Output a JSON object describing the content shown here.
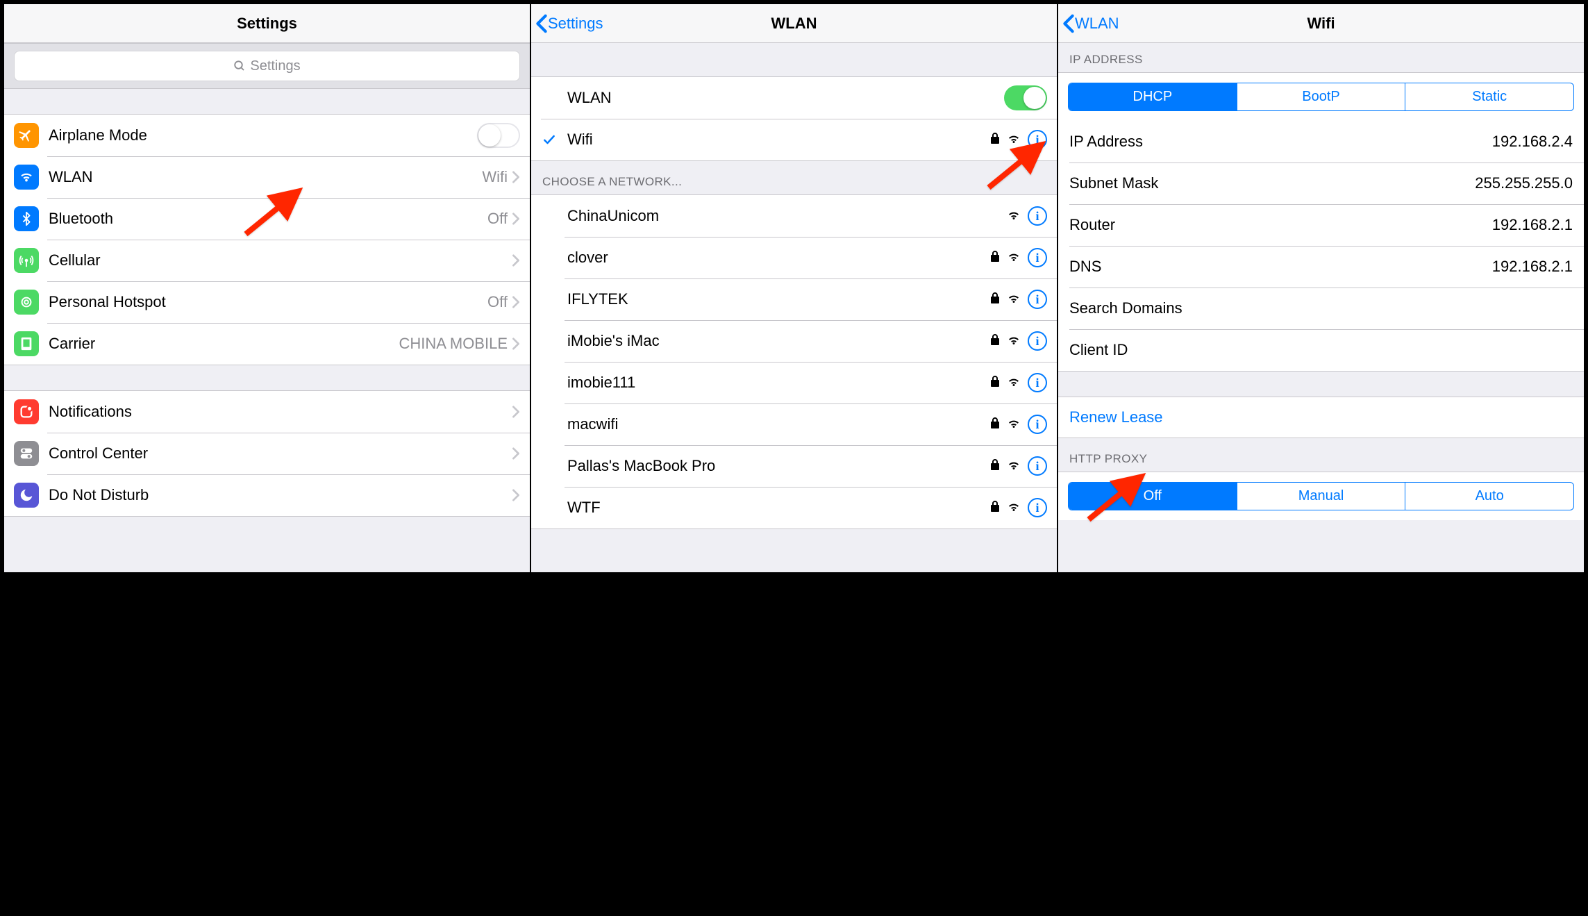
{
  "pane1": {
    "title": "Settings",
    "search_placeholder": "Settings",
    "items": [
      {
        "id": "airplane",
        "label": "Airplane Mode",
        "toggle": false,
        "iconBg": "#ff9501"
      },
      {
        "id": "wlan",
        "label": "WLAN",
        "detail": "Wifi",
        "iconBg": "#007aff"
      },
      {
        "id": "bluetooth",
        "label": "Bluetooth",
        "detail": "Off",
        "iconBg": "#007aff"
      },
      {
        "id": "cellular",
        "label": "Cellular",
        "detail": "",
        "iconBg": "#4cd964"
      },
      {
        "id": "hotspot",
        "label": "Personal Hotspot",
        "detail": "Off",
        "iconBg": "#4cd964"
      },
      {
        "id": "carrier",
        "label": "Carrier",
        "detail": "CHINA MOBILE",
        "iconBg": "#4cd964"
      }
    ],
    "group2": [
      {
        "id": "notifications",
        "label": "Notifications",
        "iconBg": "#ff3b30"
      },
      {
        "id": "controlcenter",
        "label": "Control Center",
        "iconBg": "#8e8e93"
      },
      {
        "id": "dnd",
        "label": "Do Not Disturb",
        "iconBg": "#5856d6"
      }
    ]
  },
  "pane2": {
    "back": "Settings",
    "title": "WLAN",
    "wlan_label": "WLAN",
    "wlan_on": true,
    "connected": {
      "name": "Wifi",
      "locked": true
    },
    "choose_header": "CHOOSE A NETWORK...",
    "networks": [
      {
        "name": "ChinaUnicom",
        "locked": false
      },
      {
        "name": "clover",
        "locked": true
      },
      {
        "name": "IFLYTEK",
        "locked": true
      },
      {
        "name": "iMobie's iMac",
        "locked": true
      },
      {
        "name": "imobie111",
        "locked": true
      },
      {
        "name": "macwifi",
        "locked": true
      },
      {
        "name": "Pallas's MacBook Pro",
        "locked": true
      },
      {
        "name": "WTF",
        "locked": true
      }
    ]
  },
  "pane3": {
    "back": "WLAN",
    "title": "Wifi",
    "ip_header": "IP ADDRESS",
    "ip_segments": [
      "DHCP",
      "BootP",
      "Static"
    ],
    "ip_active": 0,
    "fields": [
      {
        "k": "IP Address",
        "v": "192.168.2.4"
      },
      {
        "k": "Subnet Mask",
        "v": "255.255.255.0"
      },
      {
        "k": "Router",
        "v": "192.168.2.1"
      },
      {
        "k": "DNS",
        "v": "192.168.2.1"
      },
      {
        "k": "Search Domains",
        "v": ""
      },
      {
        "k": "Client ID",
        "v": ""
      }
    ],
    "renew": "Renew Lease",
    "proxy_header": "HTTP PROXY",
    "proxy_segments": [
      "Off",
      "Manual",
      "Auto"
    ],
    "proxy_active": 0
  }
}
